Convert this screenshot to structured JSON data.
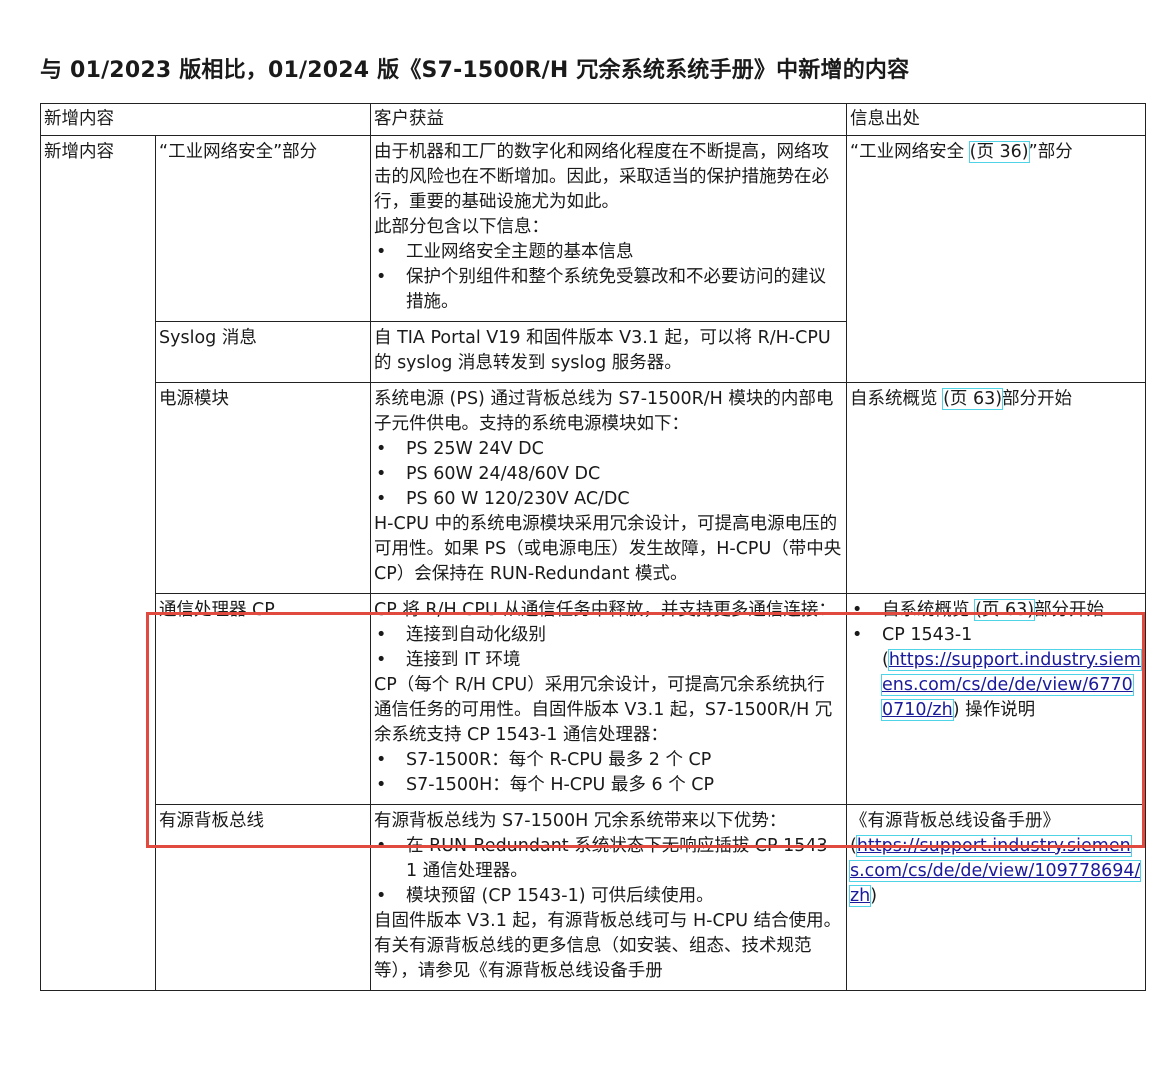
{
  "title": "与 01/2023 版相比，01/2024 版《S7-1500R/H 冗余系统系统手册》中新增的内容",
  "headers": {
    "col1": "新增内容",
    "col2": "客户获益",
    "col3": "信息出处"
  },
  "group_label": "新增内容",
  "rows": {
    "cyber": {
      "feature": "“工业网络安全”部分",
      "benefit_para": "由于机器和工厂的数字化和网络化程度在不断提高，网络攻击的风险也在不断增加。因此，采取适当的保护措施势在必行，重要的基础设施尤为如此。",
      "benefit_intro": "此部分包含以下信息：",
      "bullets": [
        "工业网络安全主题的基本信息",
        "保护个别组件和整个系统免受篡改和不必要访问的建议措施。"
      ],
      "source_pre": "“工业网络安全 ",
      "source_ref": "(页 36)",
      "source_post": "”部分"
    },
    "syslog": {
      "feature": "Syslog 消息",
      "benefit": "自 TIA Portal V19 和固件版本 V3.1 起，可以将 R/H-CPU 的 syslog 消息转发到 syslog 服务器。"
    },
    "power": {
      "feature": "电源模块",
      "benefit_para": "系统电源 (PS) 通过背板总线为 S7-1500R/H 模块的内部电子元件供电。支持的系统电源模块如下：",
      "bullets": [
        "PS 25W 24V DC",
        "PS 60W 24/48/60V DC",
        "PS 60 W 120/230V AC/DC"
      ],
      "benefit_after": "H-CPU 中的系统电源模块采用冗余设计，可提高电源电压的可用性。如果 PS（或电源电压）发生故障，H-CPU（带中央 CP）会保持在 RUN-Redundant 模式。",
      "source_pre": "自系统概览 ",
      "source_ref": "(页 63)",
      "source_post": "部分开始"
    },
    "cp": {
      "feature": "通信处理器 CP",
      "benefit_para": "CP 将 R/H CPU 从通信任务中释放，并支持更多通信连接：",
      "bullets1": [
        "连接到自动化级别",
        "连接到 IT 环境"
      ],
      "benefit_mid": "CP（每个 R/H CPU）采用冗余设计，可提高冗余系统执行通信任务的可用性。自固件版本 V3.1 起，S7-1500R/H 冗余系统支持 CP 1543-1 通信处理器：",
      "bullets2": [
        "S7-1500R：每个 R-CPU 最多 2 个 CP",
        "S7-1500H：每个 H-CPU 最多 6 个 CP"
      ],
      "source1_pre": "自系统概览 ",
      "source1_ref": "(页 63)",
      "source1_post": "部分开始",
      "source2_name": "CP 1543-1",
      "source2_paren_open": "(",
      "source2_link": "https://support.industry.siemens.com/cs/de/de/view/67700710/zh",
      "source2_post": ") 操作说明"
    },
    "abb": {
      "feature": "有源背板总线",
      "benefit_para": "有源背板总线为 S7-1500H 冗余系统带来以下优势：",
      "bullets": [
        "在 RUN-Redundant 系统状态下无响应插拔 CP 1543-1 通信处理器。",
        "模块预留 (CP 1543-1) 可供后续使用。"
      ],
      "benefit_mid": "自固件版本 V3.1 起，有源背板总线可与 H-CPU 结合使用。",
      "benefit_more": "有关有源背板总线的更多信息（如安装、组态、技术规范等），请参见《有源背板总线设备手册",
      "source_name": "《有源背板总线设备手册》",
      "source_paren_open": "(",
      "source_link": "https://support.industry.siemens.com/cs/de/de/view/109778694/zh",
      "source_paren_close": ")"
    }
  },
  "highlight_color": "#e04a3f",
  "link_outline_color": "#4fd3e6"
}
